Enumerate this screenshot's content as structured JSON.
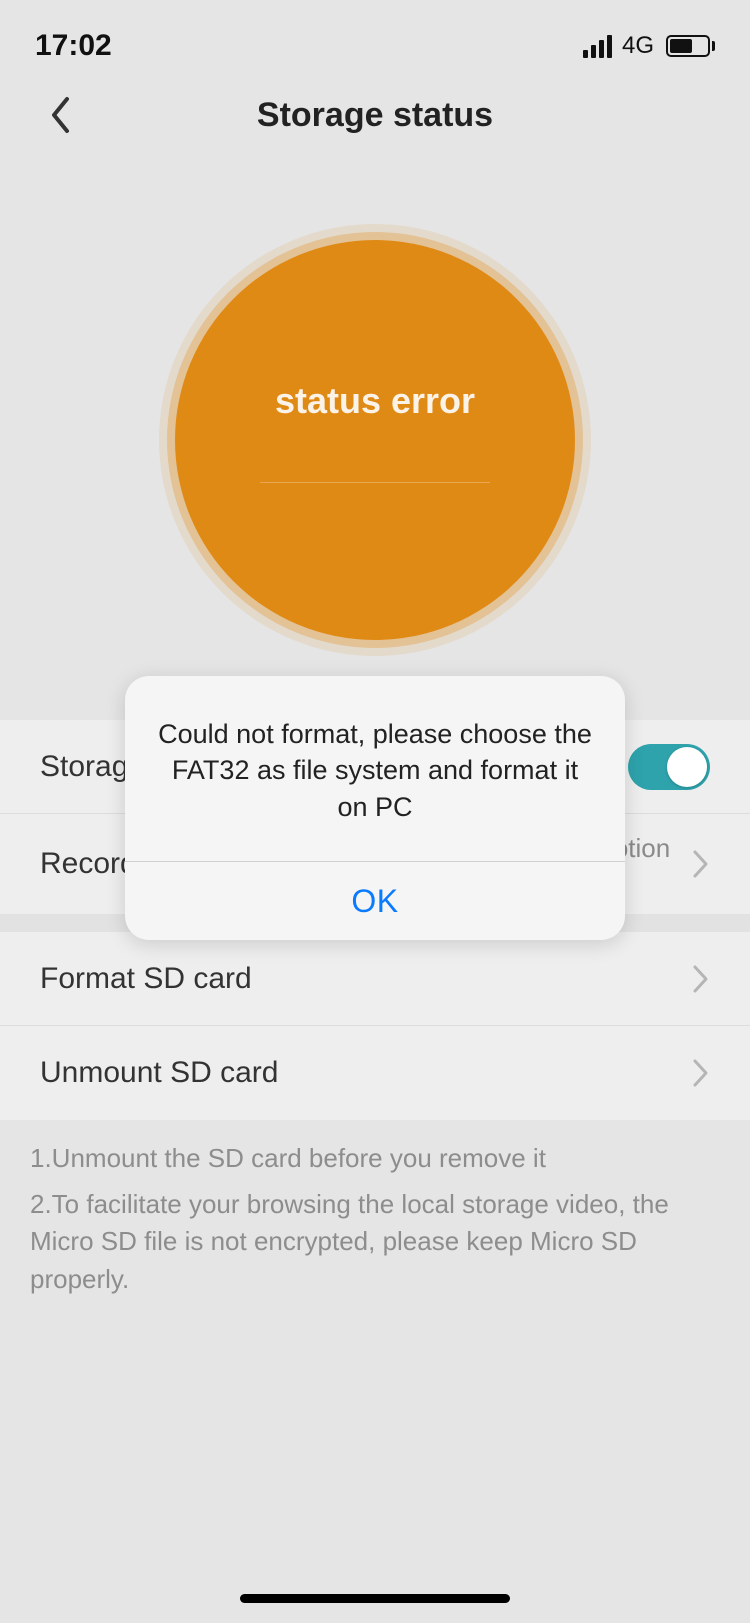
{
  "status_bar": {
    "time": "17:02",
    "network_label": "4G"
  },
  "nav": {
    "title": "Storage status"
  },
  "circle": {
    "status_text": "status error"
  },
  "settings": {
    "storage_label": "Storage",
    "recording_mode_label": "Recording Mode",
    "recording_mode_value": "Only record a video when motion is detected",
    "format_label": "Format SD card",
    "unmount_label": "Unmount SD card"
  },
  "footer": {
    "line1": "1.Unmount the SD card before you remove it",
    "line2": "2.To facilitate your browsing the local storage video, the Micro SD file is not encrypted, please keep Micro SD properly."
  },
  "dialog": {
    "message": "Could not format, please choose the FAT32 as file system and format it on PC",
    "ok_label": "OK"
  }
}
